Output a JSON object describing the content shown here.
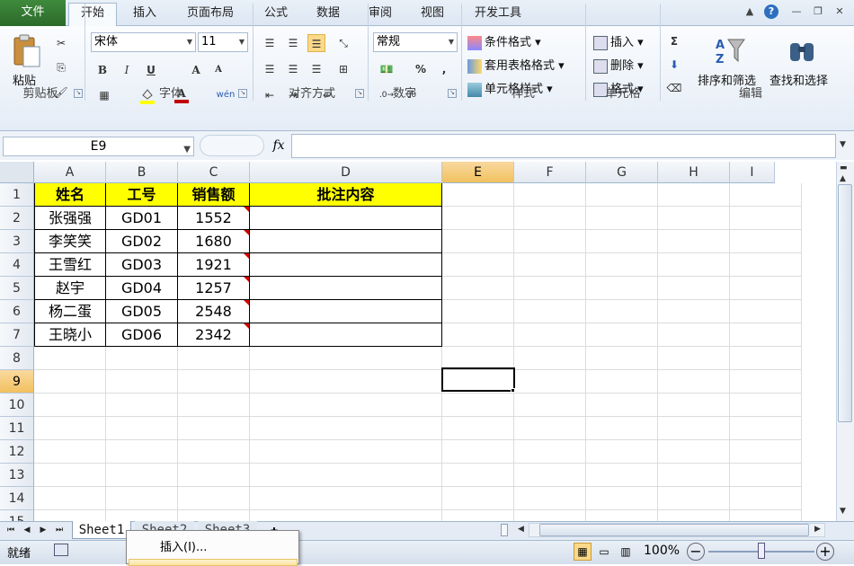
{
  "ribbon_tabs": {
    "file": "文件",
    "home": "开始",
    "insert": "插入",
    "page_layout": "页面布局",
    "formulas": "公式",
    "data": "数据",
    "review": "审阅",
    "view": "视图",
    "developer": "开发工具"
  },
  "clipboard": {
    "paste": "粘贴",
    "group": "剪贴板"
  },
  "font": {
    "name": "宋体",
    "size": "11",
    "group": "字体",
    "bold": "B",
    "italic": "I",
    "underline": "U",
    "grow": "A",
    "shrink": "A",
    "font_color_glyph": "A",
    "phonetic": "wén"
  },
  "alignment": {
    "group": "对齐方式"
  },
  "number": {
    "format": "常规",
    "percent": "%",
    "comma": ",",
    "group": "数字"
  },
  "styles": {
    "conditional": "条件格式",
    "table": "套用表格格式",
    "cell": "单元格样式",
    "group": "样式"
  },
  "cells": {
    "insert": "插入",
    "delete": "删除",
    "format": "格式",
    "group": "单元格"
  },
  "editing": {
    "sum": "Σ",
    "sort_filter": "排序和筛选",
    "find_select": "查找和选择",
    "group": "编辑"
  },
  "formula_bar": {
    "name_box": "E9",
    "fx": "fx",
    "formula": ""
  },
  "columns": [
    "A",
    "B",
    "C",
    "D",
    "E",
    "F",
    "G",
    "H",
    "I"
  ],
  "rows": [
    "1",
    "2",
    "3",
    "4",
    "5",
    "6",
    "7",
    "8",
    "9",
    "10",
    "11",
    "12",
    "13",
    "14",
    "15"
  ],
  "table": {
    "headers": [
      "姓名",
      "工号",
      "销售额",
      "批注内容"
    ],
    "data": [
      [
        "张强强",
        "GD01",
        "1552",
        ""
      ],
      [
        "李笑笑",
        "GD02",
        "1680",
        ""
      ],
      [
        "王雪红",
        "GD03",
        "1921",
        ""
      ],
      [
        "赵宇",
        "GD04",
        "1257",
        ""
      ],
      [
        "杨二蛋",
        "GD05",
        "2548",
        ""
      ],
      [
        "王晓小",
        "GD06",
        "2342",
        ""
      ]
    ]
  },
  "selected_cell": "E9",
  "sheets": [
    "Sheet1",
    "Sheet2",
    "Sheet3"
  ],
  "context_menu": {
    "insert": "插入(I)..."
  },
  "status": {
    "ready": "就绪",
    "zoom": "100%"
  }
}
